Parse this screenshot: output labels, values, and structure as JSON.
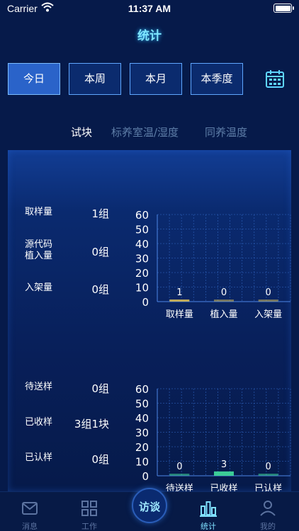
{
  "status_bar": {
    "carrier": "Carrier",
    "time": "11:37 AM"
  },
  "header": {
    "title": "统计"
  },
  "periods": [
    {
      "label": "今日",
      "active": true
    },
    {
      "label": "本周",
      "active": false
    },
    {
      "label": "本月",
      "active": false
    },
    {
      "label": "本季度",
      "active": false
    }
  ],
  "tabs": [
    {
      "label": "试块",
      "active": true
    },
    {
      "label": "标养室温/湿度",
      "active": false
    },
    {
      "label": "同养温度",
      "active": false
    }
  ],
  "section1": {
    "metrics": [
      {
        "label": "取样量",
        "value": "1组"
      },
      {
        "label": "源代码\n植入量",
        "value": "0组"
      },
      {
        "label": "入架量",
        "value": "0组"
      }
    ]
  },
  "section2": {
    "metrics": [
      {
        "label": "待送样",
        "value": "0组"
      },
      {
        "label": "已收样",
        "value": "3组1块"
      },
      {
        "label": "已认样",
        "value": "0组"
      }
    ]
  },
  "chart_data": [
    {
      "type": "bar",
      "categories": [
        "取样量",
        "植入量",
        "入架量"
      ],
      "values": [
        1,
        0,
        0
      ],
      "ylim": [
        0,
        60
      ],
      "yticks": [
        "0",
        "10",
        "20",
        "30",
        "40",
        "50",
        "60"
      ],
      "bar_color": "#c9b25a",
      "grid": true
    },
    {
      "type": "bar",
      "categories": [
        "待送样",
        "已收样",
        "已认样"
      ],
      "values": [
        0,
        3,
        0
      ],
      "ylim": [
        0,
        60
      ],
      "yticks": [
        "0",
        "10",
        "20",
        "30",
        "40",
        "50",
        "60"
      ],
      "bar_color": "#3fd69a",
      "grid": true
    }
  ],
  "tabbar": {
    "center_label": "访谈",
    "items": [
      {
        "label": "消息",
        "icon": "mail-icon",
        "active": false
      },
      {
        "label": "工作",
        "icon": "grid-icon",
        "active": false
      },
      {
        "label": "统计",
        "icon": "bar-chart-icon",
        "active": true
      },
      {
        "label": "我的",
        "icon": "user-icon",
        "active": false
      }
    ]
  },
  "colors": {
    "accent": "#7fe6ff",
    "panel": "#0a2a6f",
    "button_border": "#5fa7ff"
  }
}
